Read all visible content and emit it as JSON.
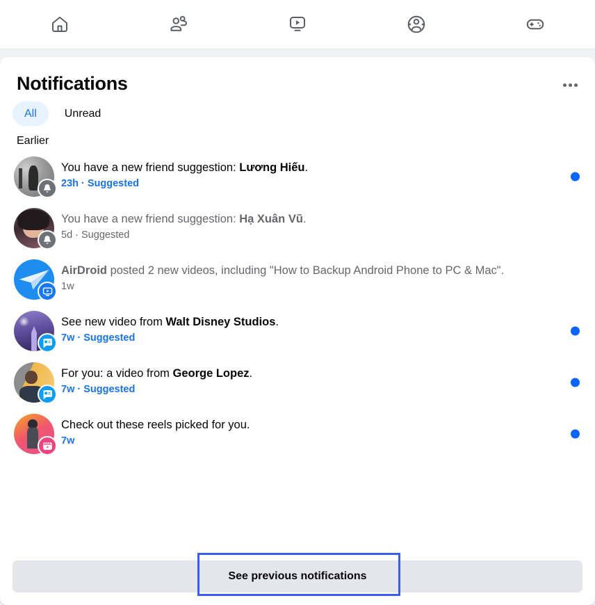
{
  "topnav": {
    "items": [
      {
        "icon": "home-icon",
        "name": "nav-home"
      },
      {
        "icon": "friends-icon",
        "name": "nav-friends"
      },
      {
        "icon": "video-icon",
        "name": "nav-video"
      },
      {
        "icon": "groups-icon",
        "name": "nav-groups"
      },
      {
        "icon": "gaming-icon",
        "name": "nav-gaming"
      }
    ]
  },
  "panel": {
    "title": "Notifications",
    "menu_icon": "ellipsis-icon",
    "tabs": [
      {
        "label": "All",
        "active": true
      },
      {
        "label": "Unread",
        "active": false
      }
    ],
    "section_label": "Earlier",
    "accent_color": "#1b74e4",
    "unread_dot_color": "#0866ff",
    "active_tab_bg": "#e7f3ff",
    "footer_button": "See previous notifications",
    "focus_ring_color": "#3b5cf0"
  },
  "notifications": [
    {
      "text_prefix": "You have a new friend suggestion: ",
      "text_bold": "Lương Hiếu",
      "text_suffix": ".",
      "time": "23h",
      "separator": " · ",
      "tag": "Suggested",
      "read": false,
      "unread_dot": true,
      "badge": "bell-icon",
      "badge_color": "#6e7277",
      "avatar": "av-grey"
    },
    {
      "text_prefix": "You have a new friend suggestion: ",
      "text_bold": "Hạ Xuân Vũ",
      "text_suffix": ".",
      "time": "5d",
      "separator": " · ",
      "tag": "Suggested",
      "read": true,
      "unread_dot": false,
      "badge": "bell-icon",
      "badge_color": "#6e7277",
      "avatar": "av-woman"
    },
    {
      "text_prefix": "",
      "text_bold": "AirDroid",
      "text_suffix": " posted 2 new videos, including \"How to Backup Android Phone to PC & Mac\".",
      "time": "1w",
      "separator": "",
      "tag": "",
      "read": true,
      "unread_dot": false,
      "badge": "video-badge-icon",
      "badge_color": "#1877f2",
      "avatar": "av-airdroid"
    },
    {
      "text_prefix": "See new video from ",
      "text_bold": "Walt Disney Studios",
      "text_suffix": ".",
      "time": "7w",
      "separator": " · ",
      "tag": "Suggested",
      "read": false,
      "unread_dot": true,
      "badge": "page-badge-icon",
      "badge_color": "#0e9df5",
      "avatar": "av-disney"
    },
    {
      "text_prefix": "For you: a video from ",
      "text_bold": "George Lopez",
      "text_suffix": ".",
      "time": "7w",
      "separator": " · ",
      "tag": "Suggested",
      "read": false,
      "unread_dot": true,
      "badge": "page-badge-icon",
      "badge_color": "#0e9df5",
      "avatar": "av-lopez"
    },
    {
      "text_prefix": "Check out these reels picked for you.",
      "text_bold": "",
      "text_suffix": "",
      "time": "7w",
      "separator": "",
      "tag": "",
      "read": false,
      "unread_dot": true,
      "badge": "reels-badge-icon",
      "badge_color": "#f0437f",
      "avatar": "av-reels"
    }
  ]
}
